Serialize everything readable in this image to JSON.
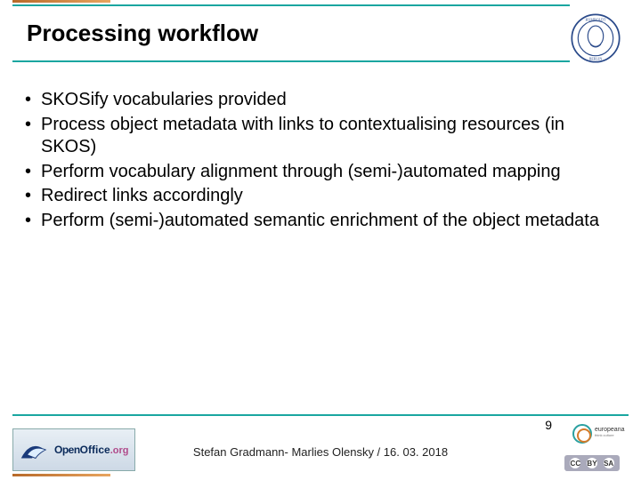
{
  "slide": {
    "title": "Processing workflow",
    "bullets": [
      "SKOSify vocabularies provided",
      "Process object metadata with links to contextualising resources (in SKOS)",
      "Perform vocabulary alignment through (semi-)automated mapping",
      "Redirect links accordingly",
      "Perform (semi-)automated semantic enrichment of the object metadata"
    ]
  },
  "footer": {
    "author_line": "Stefan Gradmann- Marlies Olensky / 16. 03. 2018",
    "page_number": "9"
  },
  "logos": {
    "openoffice_open": "Open",
    "openoffice_office": "Office",
    "openoffice_org": ".org",
    "europeana": "europeana",
    "europeana_sub": "think culture",
    "hu_seal": "Humboldt-Universität zu Berlin seal"
  },
  "cc": {
    "c1": "CC",
    "c2": "BY",
    "c3": "SA"
  }
}
